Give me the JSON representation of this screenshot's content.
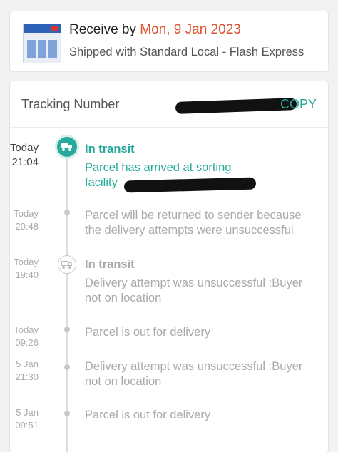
{
  "order": {
    "receive_prefix": "Receive by ",
    "receive_date": "Mon, 9 Jan 2023",
    "shipped_with": "Shipped with Standard Local - Flash Express",
    "accent_color": "#e0522d"
  },
  "tracking": {
    "label": "Tracking Number",
    "copy_label": "COPY",
    "accent_color": "#26aa99",
    "events": [
      {
        "date": "Today",
        "time": "21:04",
        "title": "In transit",
        "description": "Parcel has arrived at sorting facility",
        "icon": "truck-icon"
      },
      {
        "date": "Today",
        "time": "20:48",
        "title": "",
        "description": "Parcel will be returned to sender because the delivery attempts were unsuccessful",
        "icon": "dot"
      },
      {
        "date": "Today",
        "time": "19:40",
        "title": "In transit",
        "description": "Delivery attempt was unsuccessful :Buyer not on location",
        "icon": "truck-icon"
      },
      {
        "date": "Today",
        "time": "09:26",
        "title": "",
        "description": "Parcel is out for delivery",
        "icon": "dot"
      },
      {
        "date": "5 Jan",
        "time": "21:30",
        "title": "",
        "description": "Delivery attempt was unsuccessful :Buyer not on location",
        "icon": "dot"
      },
      {
        "date": "5 Jan",
        "time": "09:51",
        "title": "",
        "description": "Parcel is out for delivery",
        "icon": "dot"
      }
    ]
  }
}
